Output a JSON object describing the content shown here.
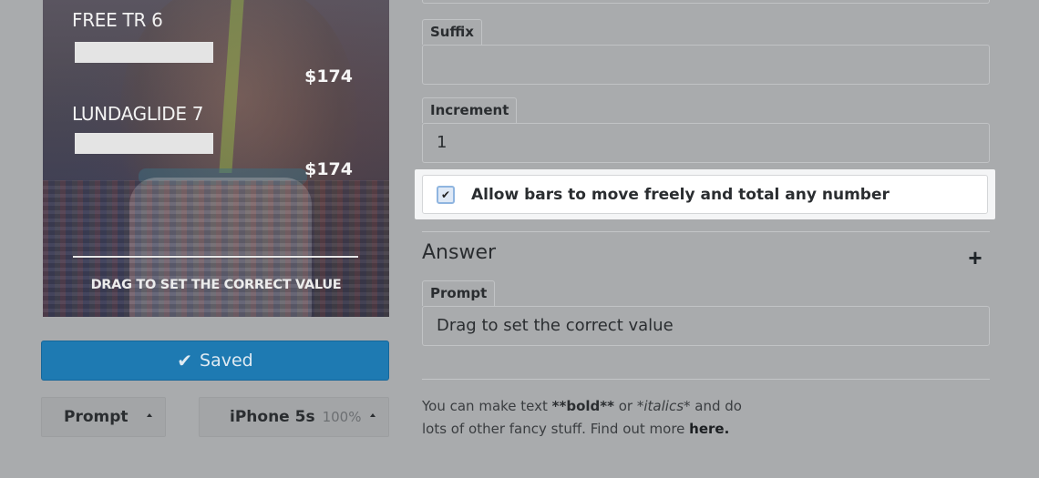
{
  "preview": {
    "items": [
      {
        "name": "FREE TR 6",
        "price": "$174"
      },
      {
        "name": "LUNDAGLIDE 7",
        "price": "$174"
      }
    ],
    "footer_text": "DRAG TO SET THE CORRECT VALUE"
  },
  "saved_button": {
    "label": "Saved",
    "icon": "check-icon"
  },
  "view_select": {
    "label": "Prompt"
  },
  "device_select": {
    "label": "iPhone 5s",
    "zoom": "100%"
  },
  "form": {
    "suffix": {
      "label": "Suffix",
      "value": ""
    },
    "increment": {
      "label": "Increment",
      "value": "1"
    },
    "free_bars": {
      "label": "Allow bars to move freely and total any number",
      "checked": true
    }
  },
  "answer": {
    "title": "Answer",
    "add_label": "+",
    "prompt": {
      "label": "Prompt",
      "value": "Drag to set the correct value"
    }
  },
  "help": {
    "part1": "You can make text ",
    "bold": "**bold**",
    "part2": " or ",
    "italics": "*italics*",
    "part3": " and do lots of other fancy stuff. Find out more ",
    "link": "here."
  },
  "colors": {
    "overlay": "#a9abad",
    "primary_button": "#1e7ab2",
    "highlight": "#ffffff"
  }
}
